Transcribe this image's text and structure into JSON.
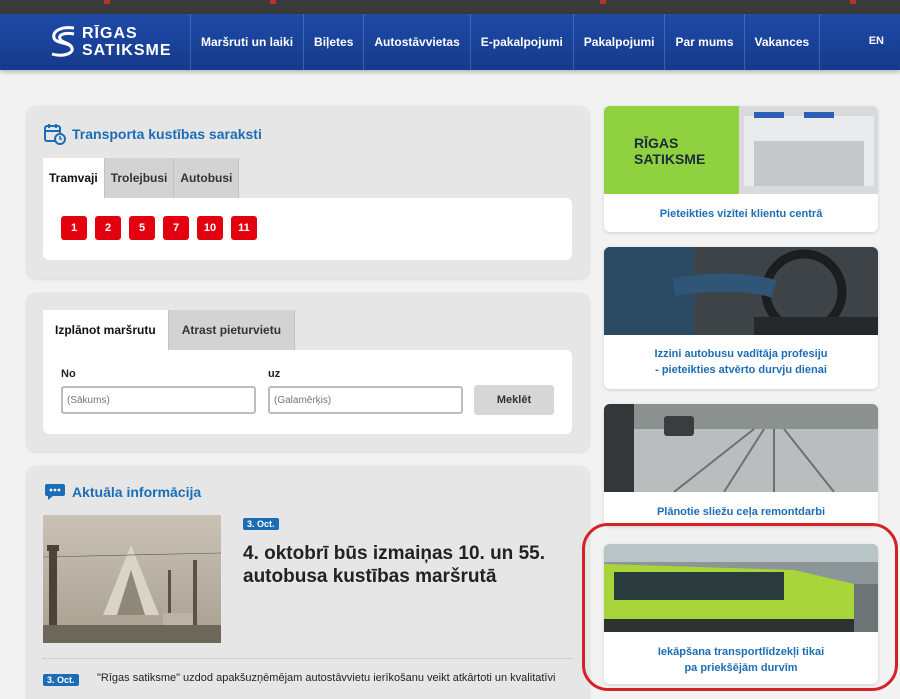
{
  "brand": {
    "line1": "RĪGAS",
    "line2": "SATIKSME"
  },
  "nav": [
    "Maršruti un laiki",
    "Biļetes",
    "Autostāvvietas",
    "E-pakalpojumi",
    "Pakalpojumi",
    "Par mums",
    "Vakances"
  ],
  "language": "EN",
  "timetables": {
    "title": "Transporta kustības saraksti",
    "tabs": [
      "Tramvaji",
      "Trolejbusi",
      "Autobusi"
    ],
    "active_tab": "Tramvaji",
    "routes": [
      "1",
      "2",
      "5",
      "7",
      "10",
      "11"
    ]
  },
  "planner": {
    "tabs": [
      "Izplānot maršrutu",
      "Atrast pieturvietu"
    ],
    "from_label": "No",
    "from_placeholder": "(Sākums)",
    "to_label": "uz",
    "to_placeholder": "(Galamērķis)",
    "search_label": "Meklēt"
  },
  "news": {
    "title": "Aktuāla informācija",
    "items": [
      {
        "date": "3. Oct.",
        "text": "4. oktobrī būs izmaiņas 10. un 55. autobusa kustības maršrutā"
      },
      {
        "date": "3. Oct.",
        "text": "\"Rīgas satiksme\" uzdod apakšuzņēmējam autostāvvietu ierīkošanu veikt atkārtoti un kvalitatīvi"
      }
    ]
  },
  "promos": [
    {
      "text": "Pieteikties vizītei klientu centrā"
    },
    {
      "text": "Izzini autobusu vadītāja profesiju",
      "text2": "- pieteikties atvērto durvju dienai"
    },
    {
      "text": "Plānotie sliežu ceļa remontdarbi"
    },
    {
      "text": "Iekāpšana transportlīdzekļi tikai",
      "text2": "pa priekšējām durvīm"
    }
  ],
  "colors": {
    "header": "#1e4aa8",
    "accent": "#1c6db6",
    "route": "#e3000f",
    "highlight": "#d42228"
  }
}
